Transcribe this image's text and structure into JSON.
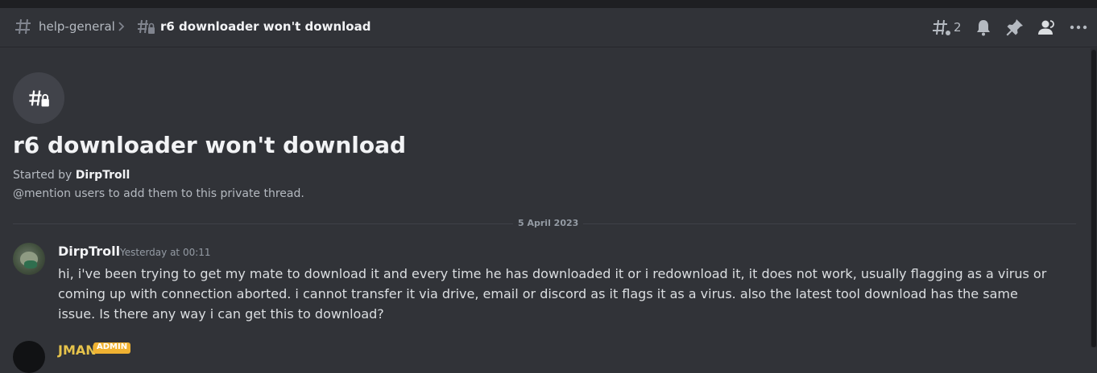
{
  "header": {
    "parent_channel": "help-general",
    "thread_title": "r6 downloader won't download",
    "threads_count": "2",
    "icons": [
      "hash-icon",
      "chevron-right-icon",
      "thread-lock-icon",
      "threads-icon",
      "bell-icon",
      "pin-icon",
      "members-icon",
      "more-icon"
    ]
  },
  "thread": {
    "title": "r6 downloader won't download",
    "started_by_prefix": "Started by",
    "started_by_user": "DirpTroll",
    "mention_hint": "@mention users to add them to this private thread."
  },
  "divider": {
    "date": "5 April 2023"
  },
  "messages": [
    {
      "author": "DirpTroll",
      "timestamp": "Yesterday at 00:11",
      "text": "hi, i've been trying to get my mate to download it and every time he has downloaded it or i redownload it, it does not work, usually flagging as a virus or coming up with connection aborted. i cannot transfer it via drive, email or discord as it flags it as a virus. also the latest tool download has the same issue. Is there any way i can get this to download?"
    },
    {
      "author": "JMAN",
      "badge": "ADMIN"
    }
  ],
  "colors": {
    "background": "#313338",
    "header_text": "#f2f3f5",
    "muted_text": "#b5bac1",
    "admin_badge": "#f0b232"
  }
}
